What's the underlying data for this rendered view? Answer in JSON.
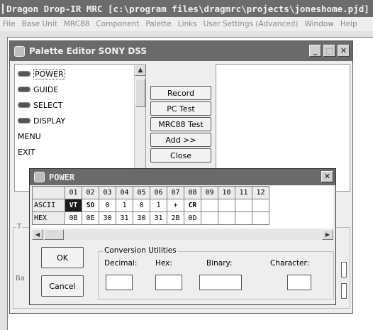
{
  "app": {
    "title": "Dragon Drop-IR MRC [c:\\program files\\dragmrc\\projects\\joneshome.pjd] (Me"
  },
  "menu": [
    "File",
    "Base Unit",
    "MRC88",
    "Component",
    "Palette",
    "Links",
    "User Settings (Advanced)",
    "Window",
    "Help"
  ],
  "palette": {
    "title": "Palette Editor SONY DSS",
    "items": [
      {
        "label": "POWER",
        "has_icon": true
      },
      {
        "label": "GUIDE",
        "has_icon": true
      },
      {
        "label": "SELECT",
        "has_icon": true
      },
      {
        "label": "DISPLAY",
        "has_icon": true
      },
      {
        "label": "MENU",
        "has_icon": false
      },
      {
        "label": "EXIT",
        "has_icon": false
      }
    ],
    "buttons": {
      "record": "Record",
      "pc_test": "PC Test",
      "mrc88_test": "MRC88 Test",
      "add": "Add >>",
      "close": "Close"
    },
    "group_label_fragment": "T",
    "side_label_fragment": "Ba"
  },
  "power_dialog": {
    "title": "POWER",
    "columns": [
      "01",
      "02",
      "03",
      "04",
      "05",
      "06",
      "07",
      "08",
      "09",
      "10",
      "11",
      "12"
    ],
    "rows": [
      {
        "label": "ASCII",
        "cells": [
          "VT",
          "SO",
          "0",
          "1",
          "0",
          "1",
          "+",
          "CR",
          "",
          "",
          "",
          ""
        ]
      },
      {
        "label": "HEX",
        "cells": [
          "0B",
          "0E",
          "30",
          "31",
          "30",
          "31",
          "2B",
          "0D",
          "",
          "",
          "",
          ""
        ]
      }
    ],
    "ok": "OK",
    "cancel": "Cancel",
    "conversion": {
      "title": "Conversion Utilities",
      "decimal": "Decimal:",
      "hex": "Hex:",
      "binary": "Binary:",
      "character": "Character:"
    }
  },
  "icons": {
    "window_minimize": "minimize-icon",
    "window_maximize": "maximize-icon",
    "window_close": "close-icon"
  }
}
